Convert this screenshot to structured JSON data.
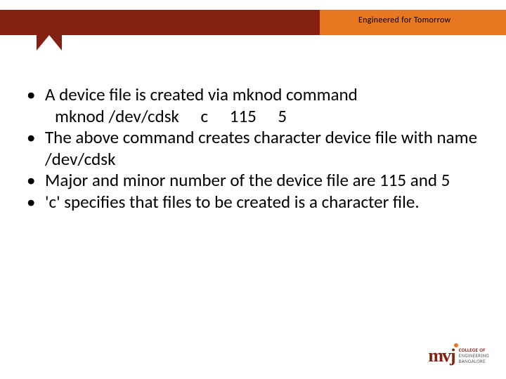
{
  "header": {
    "tagline": "Engineered for Tomorrow"
  },
  "bullets": [
    {
      "text": "A device file is created via mknod command",
      "sub": "mknod /dev/cdsk  c  115  5"
    },
    {
      "text": "The above command creates character device file with name /dev/cdsk"
    },
    {
      "text": "Major and minor number of the device file are 115 and 5"
    },
    {
      "text": "'c' specifies that files to be created is a character file."
    }
  ],
  "logo": {
    "mark": "mvj",
    "line1": "College of",
    "line2": "Engineering",
    "line3": "Bangalore"
  }
}
